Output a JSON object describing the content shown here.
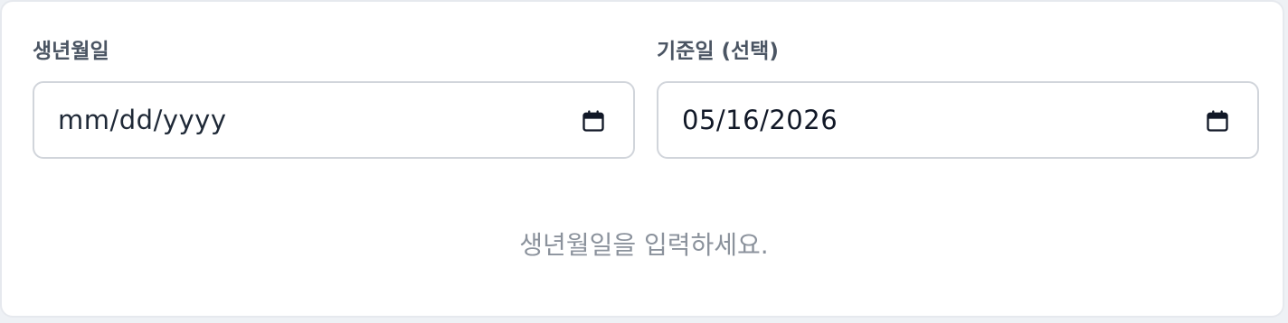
{
  "form": {
    "birth": {
      "label": "생년월일",
      "value": "mm/dd/yyyy"
    },
    "reference": {
      "label": "기준일 (선택)",
      "value": "05/16/2026"
    },
    "hint": "생년월일을 입력하세요."
  },
  "colors": {
    "label": "#4b5563",
    "border": "#d1d5db",
    "hint": "#8b929c"
  },
  "icons": {
    "birth_picker": "calendar-icon",
    "reference_picker": "calendar-icon"
  }
}
